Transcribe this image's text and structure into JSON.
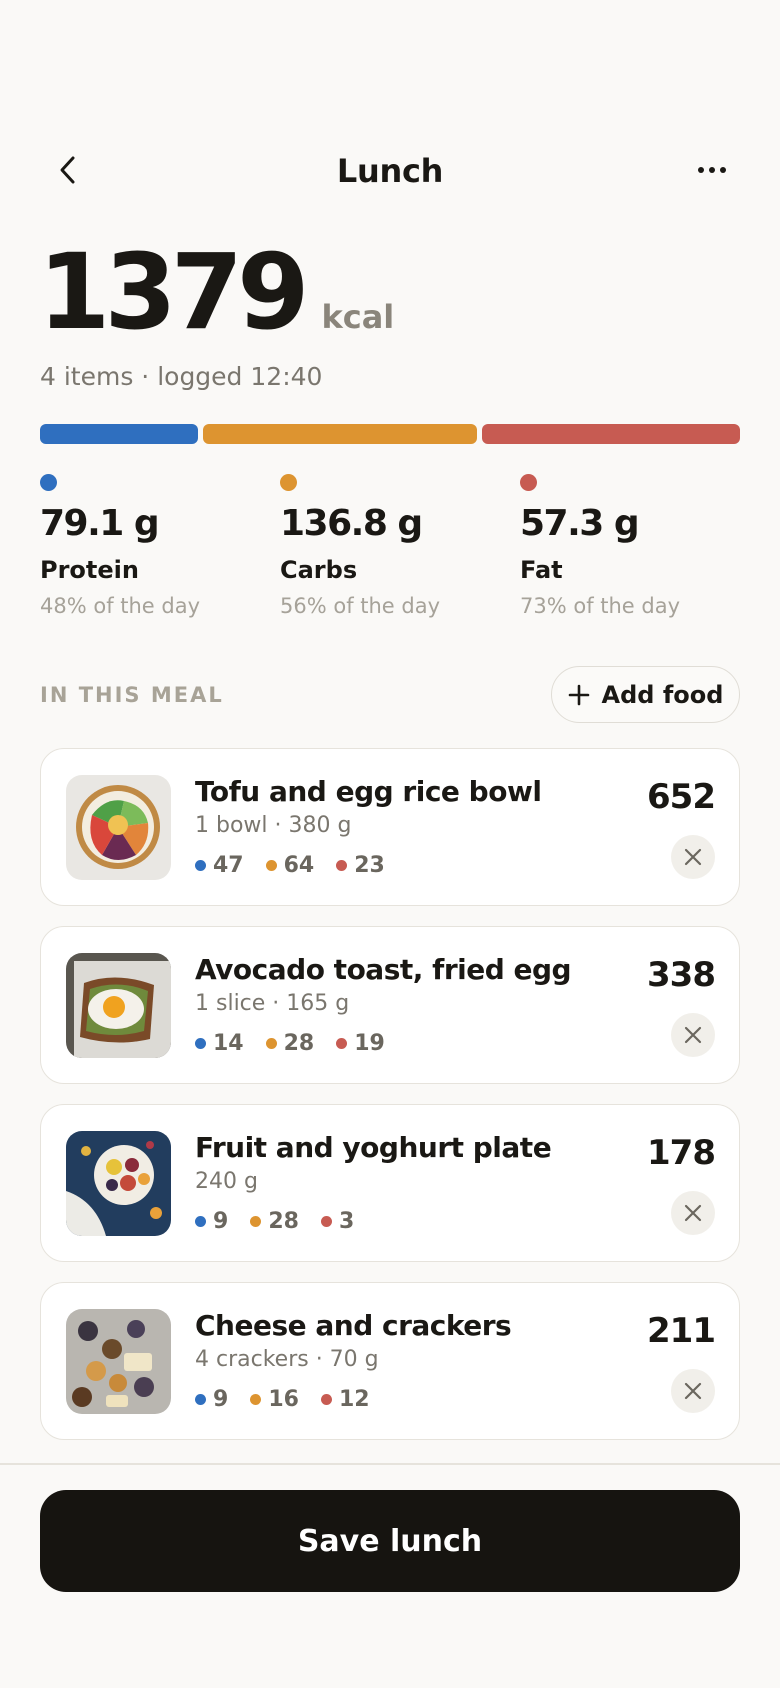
{
  "header": {
    "title": "Lunch",
    "back_icon": "chevron-left-icon",
    "more_icon": "more-horizontal-icon"
  },
  "summary": {
    "kcal": "1379",
    "unit": "kcal",
    "meta": "4 items · logged 12:40"
  },
  "colors": {
    "protein": "#2f6fbf",
    "carbs": "#dd9430",
    "fat": "#c75b52"
  },
  "macro_bar": {
    "protein_share": 0.226,
    "carbs_share": 0.392,
    "fat_share": 0.369
  },
  "macros": [
    {
      "grams": "79.1 g",
      "name": "Protein",
      "pct": "48% of the day"
    },
    {
      "grams": "136.8 g",
      "name": "Carbs",
      "pct": "56% of the day"
    },
    {
      "grams": "57.3 g",
      "name": "Fat",
      "pct": "73% of the day"
    }
  ],
  "section": {
    "label": "IN THIS MEAL",
    "add_label": "Add food"
  },
  "items": [
    {
      "name": "Tofu and egg rice bowl",
      "portion": "1 bowl · 380 g",
      "protein": "47",
      "carbs": "64",
      "fat": "23",
      "kcal": "652"
    },
    {
      "name": "Avocado toast, fried egg",
      "portion": "1 slice · 165 g",
      "protein": "14",
      "carbs": "28",
      "fat": "19",
      "kcal": "338"
    },
    {
      "name": "Fruit and yoghurt plate",
      "portion": "240 g",
      "protein": "9",
      "carbs": "28",
      "fat": "3",
      "kcal": "178"
    },
    {
      "name": "Cheese and crackers",
      "portion": "4 crackers · 70 g",
      "protein": "9",
      "carbs": "16",
      "fat": "12",
      "kcal": "211"
    }
  ],
  "footer": {
    "save_label": "Save lunch"
  }
}
